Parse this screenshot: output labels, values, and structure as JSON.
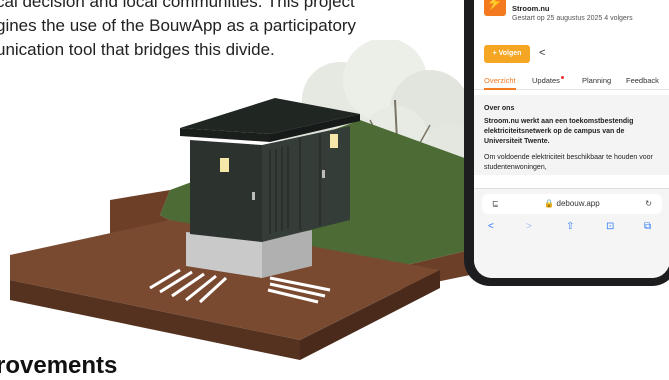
{
  "intro": {
    "line1": "cal decision and local communities. This project",
    "line2": "gines the use of the BouwApp as a participatory",
    "line3": "unication tool that bridges this divide."
  },
  "heading": "rovements",
  "phone": {
    "logo": "⚡",
    "project_name": "Stroom.nu",
    "project_meta": "Gestart op 25 augustus 2025   4 volgers",
    "follow_label": "+ Volgen",
    "share_icon": "<",
    "tabs": [
      "Overzicht",
      "Updates",
      "Planning",
      "Feedback"
    ],
    "about_title": "Over ons",
    "about_bold": "Stroom.nu werkt aan een toekomstbestendig elektriciteitsnetwerk op de campus van de Universiteit Twente.",
    "about_body": "Om voldoende elektriciteit beschikbaar te houden voor studentenwoningen,",
    "url_left_icon": "⊑",
    "url": "🔒 debouw.app",
    "url_right_icon": "↻",
    "nav": [
      "<",
      ">",
      "⇧",
      "⊡",
      "⧉"
    ]
  },
  "colors": {
    "accent": "#f47a20",
    "follow_button": "#f5a623",
    "cabinet": "#2c332f",
    "ground": "#7a4a30",
    "grass": "#4d6b34"
  }
}
